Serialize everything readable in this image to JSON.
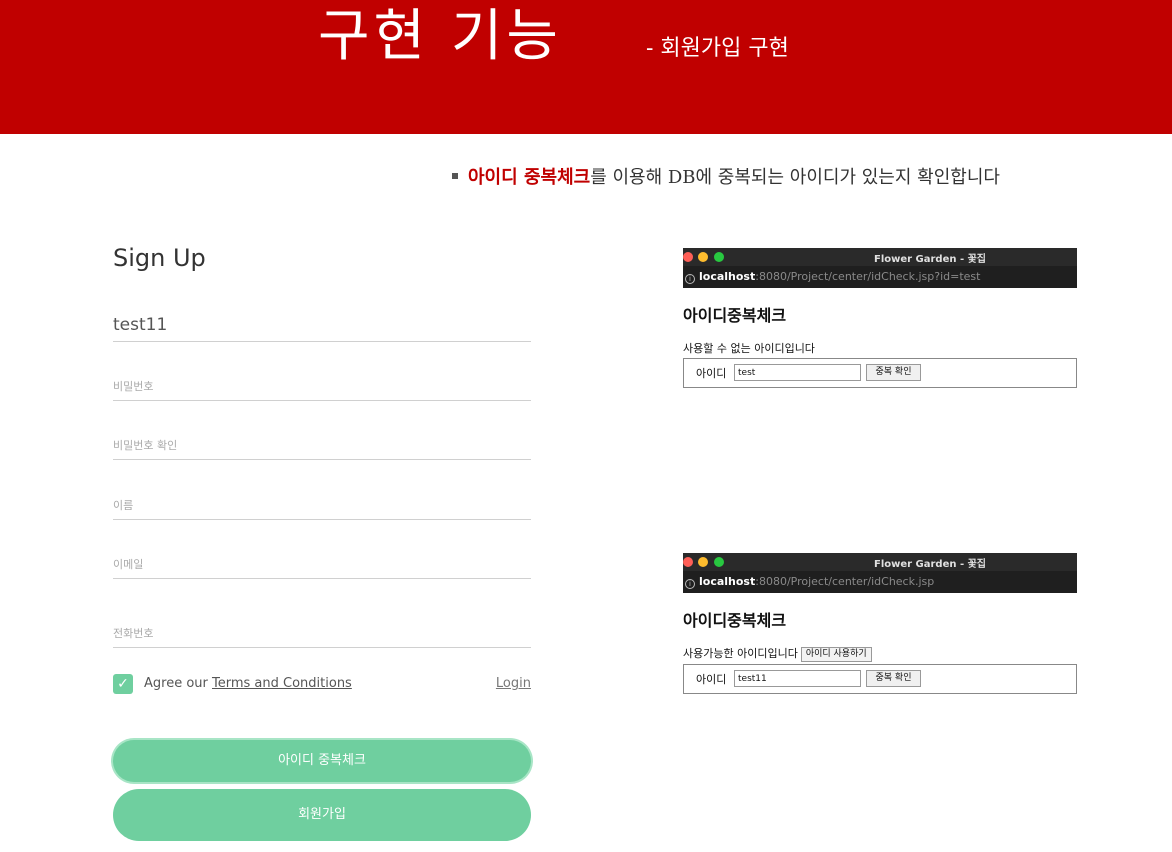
{
  "banner": {
    "title": "구현 기능",
    "subtitle": "- 회원가입 구현",
    "color": "#c00000"
  },
  "description": {
    "highlight": "아이디 중복체크",
    "rest": "를 이용해 DB에 중복되는 아이디가 있는지 확인합니다"
  },
  "signup": {
    "title": "Sign Up",
    "id_value": "test11",
    "password_placeholder": "비밀번호",
    "password_confirm_placeholder": "비밀번호 확인",
    "name_placeholder": "이름",
    "email_placeholder": "이메일",
    "phone_placeholder": "전화번호",
    "agree_prefix": "Agree our",
    "terms_label": "Terms and Conditions",
    "login_label": "Login",
    "agree_checked": true,
    "check_button": "아이디 중복체크",
    "submit_button": "회원가입",
    "accent_color": "#6fcf9f"
  },
  "windows": [
    {
      "title": "Flower Garden - 꽃집",
      "url_host": "localhost",
      "url_rest": ":8080/Project/center/idCheck.jsp?id=test",
      "heading": "아이디중복체크",
      "status": "사용할 수 없는 아이디입니다",
      "field_label": "아이디",
      "field_value": "test",
      "dup_button": "중복 확인"
    },
    {
      "title": "Flower Garden - 꽃집",
      "url_host": "localhost",
      "url_rest": ":8080/Project/center/idCheck.jsp",
      "heading": "아이디중복체크",
      "status": "사용가능한 아이디입니다",
      "use_button": "아이디 사용하기",
      "field_label": "아이디",
      "field_value": "test11",
      "dup_button": "중복 확인"
    }
  ]
}
